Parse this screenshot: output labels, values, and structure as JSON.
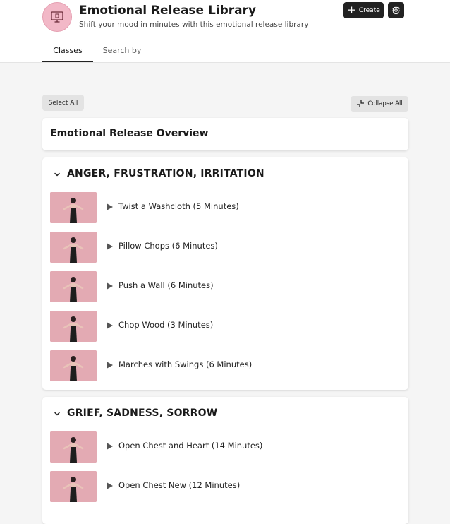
{
  "header": {
    "title": "Emotional Release Library",
    "subtitle": "Shift your mood in minutes with this emotional release library",
    "create_label": "Create",
    "logo_icon": "monitor-icon",
    "settings_icon": "gear-icon"
  },
  "tabs": [
    {
      "label": "Classes",
      "active": true
    },
    {
      "label": "Search by",
      "active": false
    }
  ],
  "toolbar": {
    "select_all_label": "Select All",
    "collapse_all_label": "Collapse All"
  },
  "overview": {
    "title": "Emotional Release Overview"
  },
  "sections": [
    {
      "title": "ANGER, FRUSTRATION, IRRITATION",
      "items": [
        {
          "label": "Twist a Washcloth (5 Minutes)"
        },
        {
          "label": "Pillow Chops (6 Minutes)"
        },
        {
          "label": "Push a Wall (6 Minutes)"
        },
        {
          "label": "Chop Wood (3 Minutes)"
        },
        {
          "label": "Marches with Swings (6 Minutes)"
        }
      ]
    },
    {
      "title": "GRIEF, SADNESS, SORROW",
      "items": [
        {
          "label": "Open Chest and Heart (14 Minutes)"
        },
        {
          "label": "Open Chest New (12 Minutes)"
        }
      ]
    }
  ],
  "colors": {
    "accent": "#222222",
    "logo_bg": "#f2b8c7",
    "thumbnail_bg": "#e3aab3",
    "page_bg": "#f5f5f5"
  }
}
